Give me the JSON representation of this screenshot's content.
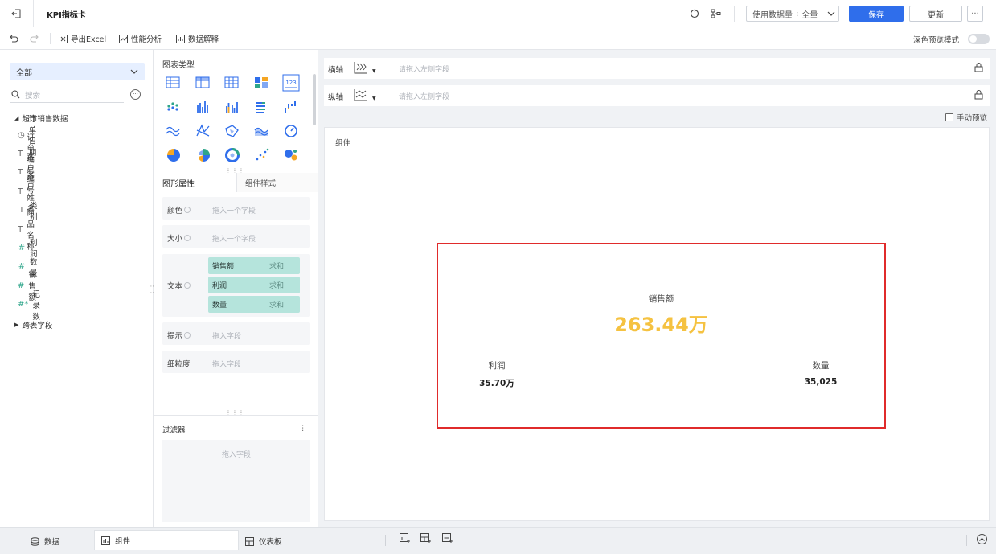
{
  "app": {
    "title": "KPI指标卡"
  },
  "header": {
    "data_source_label": "使用数据量",
    "data_source_value": "全量",
    "save_label": "保存",
    "update_label": "更新",
    "more_label": "···"
  },
  "toolbar": {
    "export_label": "导出Excel",
    "perf_label": "性能分析",
    "explain_label": "数据解释",
    "dark_mode_label": "深色预览模式",
    "dark_mode_on": false
  },
  "left": {
    "dataset_select": "全部",
    "search_placeholder": "搜索",
    "search_more": "···",
    "tree_root": "超市销售数据",
    "fields": [
      {
        "icon": "clock-icon",
        "glyph": "◷",
        "label": "订单日期",
        "type": "date"
      },
      {
        "icon": "text-field-icon",
        "glyph": "T",
        "label": "订单编号",
        "type": "text"
      },
      {
        "icon": "text-field-icon",
        "glyph": "T",
        "label": "客户编号",
        "type": "text"
      },
      {
        "icon": "text-field-icon",
        "glyph": "T",
        "label": "客户姓名",
        "type": "text"
      },
      {
        "icon": "text-field-icon",
        "glyph": "T",
        "label": "类别",
        "type": "text"
      },
      {
        "icon": "text-field-icon",
        "glyph": "T",
        "label": "商品名称",
        "type": "text"
      },
      {
        "icon": "number-field-icon",
        "glyph": "#",
        "label": "利润",
        "type": "num"
      },
      {
        "icon": "number-field-icon",
        "glyph": "#",
        "label": "数量",
        "type": "num"
      },
      {
        "icon": "number-field-icon",
        "glyph": "#",
        "label": "销售额",
        "type": "num"
      },
      {
        "icon": "count-field-icon",
        "glyph": "#*",
        "label": "记录数",
        "type": "num"
      }
    ],
    "cross_table": "跨表字段"
  },
  "middle": {
    "chart_types_title": "图表类型",
    "tabs": {
      "prop": "图形属性",
      "style": "组件样式"
    },
    "props": {
      "color_label": "颜色",
      "color_ph": "拖入一个字段",
      "size_label": "大小",
      "size_ph": "拖入一个字段",
      "text_label": "文本",
      "text_chips": [
        {
          "field": "销售额",
          "agg": "求和"
        },
        {
          "field": "利润",
          "agg": "求和"
        },
        {
          "field": "数量",
          "agg": "求和"
        }
      ],
      "tip_label": "提示",
      "tip_ph": "拖入字段",
      "granularity_label": "细粒度",
      "granularity_ph": "拖入字段"
    },
    "filter_title": "过滤器",
    "filter_more": "⋮",
    "filter_ph": "拖入字段"
  },
  "axes": {
    "x_label": "横轴",
    "y_label": "纵轴",
    "x_ph": "请拖入左侧字段",
    "y_ph": "请拖入左侧字段",
    "manual_preview": "手动预览"
  },
  "canvas": {
    "label": "组件",
    "kpi": {
      "main_label": "销售额",
      "main_value": "263.44万",
      "main_color": "#f5c241",
      "left_label": "利润",
      "left_value": "35.70万",
      "right_label": "数量",
      "right_value": "35,025"
    }
  },
  "bottom": {
    "tab_data": "数据",
    "tab_component": "组件",
    "tab_dashboard": "仪表板"
  },
  "colors": {
    "accent": "#2f6eeb",
    "chip": "#b5e4dc",
    "highlight_border": "#e02b2b"
  }
}
